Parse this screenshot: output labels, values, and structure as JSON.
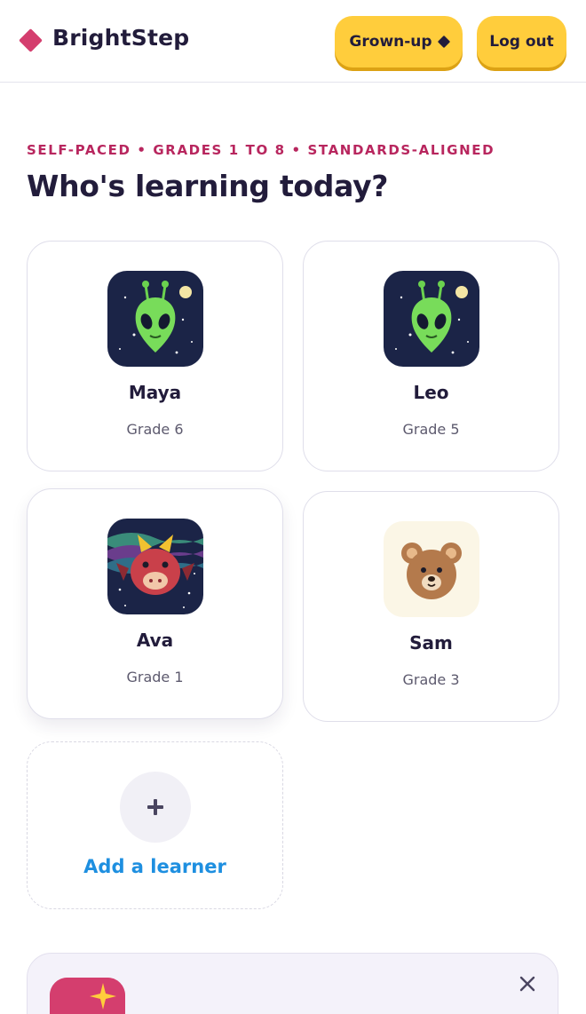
{
  "header": {
    "brand": "BrightStep",
    "grownup_label": "Grown-up",
    "logout_label": "Log out"
  },
  "hero": {
    "eyebrow": "SELF-PACED • GRADES 1 TO 8 • STANDARDS-ALIGNED",
    "title": "Who's learning today?"
  },
  "learners": [
    {
      "name": "Maya",
      "grade": "Grade 6",
      "avatar": "alien-icon"
    },
    {
      "name": "Leo",
      "grade": "Grade 5",
      "avatar": "alien-icon"
    },
    {
      "name": "Ava",
      "grade": "Grade 1",
      "avatar": "dragon-icon"
    },
    {
      "name": "Sam",
      "grade": "Grade 3",
      "avatar": "bear-icon"
    }
  ],
  "add_learner": {
    "label": "Add a learner",
    "icon": "plus-icon"
  },
  "promo": {
    "icon": "sparkle-gift-icon",
    "close_icon": "close-icon"
  },
  "colors": {
    "brand_pink": "#d43e6e",
    "eyebrow": "#b8265e",
    "button_yellow": "#ffcd3c",
    "link_blue": "#1e8fe0",
    "text_dark": "#221c3b"
  }
}
